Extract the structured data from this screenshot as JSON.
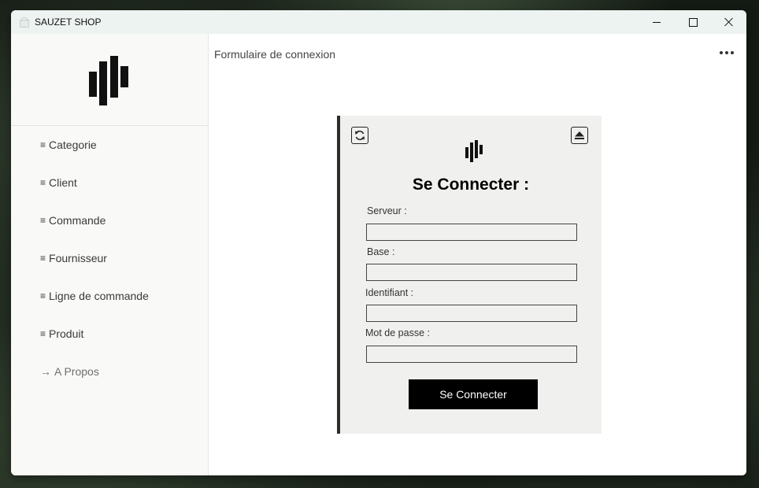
{
  "window": {
    "title": "SAUZET SHOP"
  },
  "sidebar": {
    "items": [
      {
        "symbol": "≡",
        "label": "Categorie"
      },
      {
        "symbol": "≡",
        "label": "Client"
      },
      {
        "symbol": "≡",
        "label": "Commande"
      },
      {
        "symbol": "≡",
        "label": "Fournisseur"
      },
      {
        "symbol": "≡",
        "label": "Ligne de commande"
      },
      {
        "symbol": "≡",
        "label": "Produit"
      },
      {
        "symbol": "→",
        "label": "A Propos"
      }
    ]
  },
  "main": {
    "page_title": "Formulaire de connexion"
  },
  "login": {
    "heading": "Se Connecter :",
    "fields": [
      {
        "label": "Serveur :",
        "value": ""
      },
      {
        "label": "Base :",
        "value": ""
      },
      {
        "label": "Identifiant :",
        "value": ""
      },
      {
        "label": "Mot de passe :",
        "value": ""
      }
    ],
    "submit_label": "Se Connecter"
  },
  "icons": {
    "app": "store-icon",
    "logo": "bars-logo-icon",
    "refresh": "refresh-icon",
    "eject": "eject-icon",
    "more": "more-horizontal-icon"
  },
  "colors": {
    "titlebar": "#edf3f1",
    "sidebar": "#f9f9f7",
    "card": "#f0f0ee",
    "card_accent": "#2f2b28",
    "button": "#000000"
  }
}
